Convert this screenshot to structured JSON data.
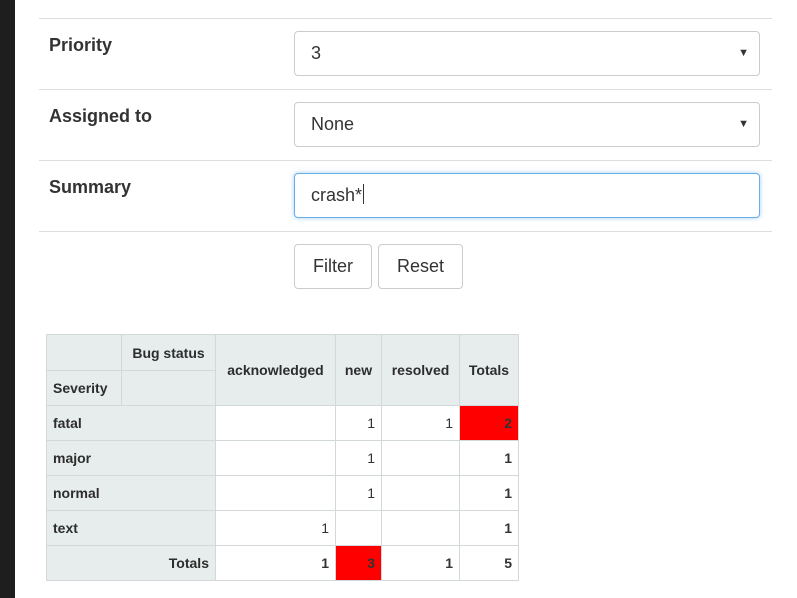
{
  "form": {
    "priority": {
      "label": "Priority",
      "value": "3"
    },
    "assigned": {
      "label": "Assigned to",
      "value": "None"
    },
    "summary": {
      "label": "Summary",
      "value": "crash*"
    },
    "buttons": {
      "filter": "Filter",
      "reset": "Reset"
    }
  },
  "pivot": {
    "col_dim": "Bug status",
    "row_dim": "Severity",
    "columns": [
      "acknowledged",
      "new",
      "resolved",
      "Totals"
    ],
    "rows": [
      {
        "label": "fatal",
        "cells": [
          "",
          "1",
          "1",
          "2"
        ]
      },
      {
        "label": "major",
        "cells": [
          "",
          "1",
          "",
          "1"
        ]
      },
      {
        "label": "normal",
        "cells": [
          "",
          "1",
          "",
          "1"
        ]
      },
      {
        "label": "text",
        "cells": [
          "1",
          "",
          "",
          "1"
        ]
      }
    ],
    "totals": {
      "label": "Totals",
      "cells": [
        "1",
        "3",
        "1",
        "5"
      ]
    },
    "highlight_color": "#ff0000"
  }
}
